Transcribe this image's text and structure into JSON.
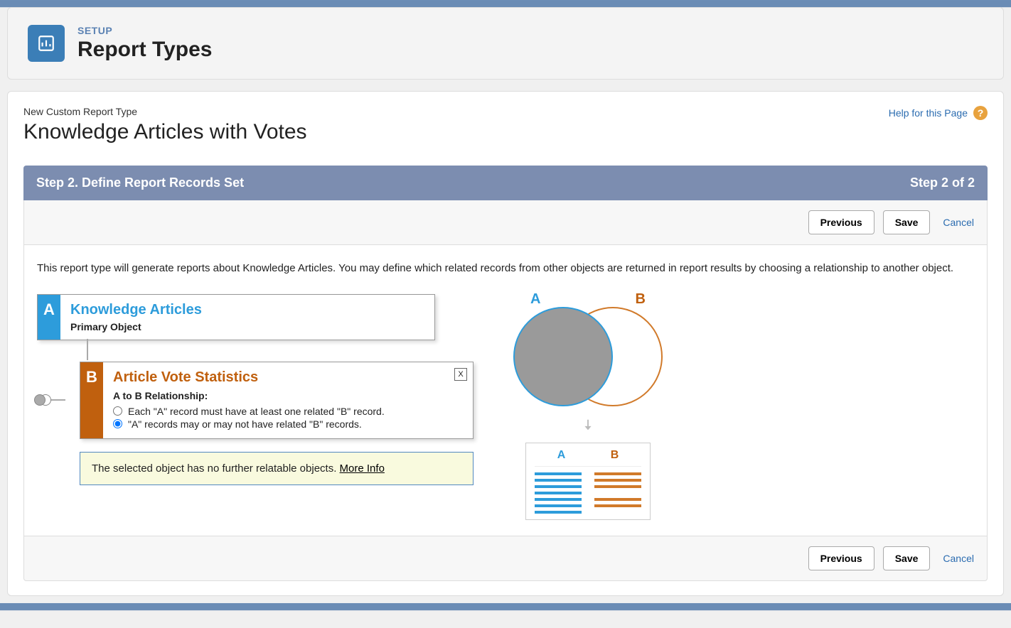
{
  "header": {
    "setup_label": "SETUP",
    "page_title": "Report Types"
  },
  "page": {
    "breadcrumb": "New Custom Report Type",
    "title": "Knowledge Articles with Votes",
    "help_label": "Help for this Page"
  },
  "step": {
    "label": "Step 2. Define Report Records Set",
    "counter": "Step 2 of 2"
  },
  "buttons": {
    "previous": "Previous",
    "save": "Save",
    "cancel": "Cancel"
  },
  "description": "This report type will generate reports about Knowledge Articles. You may define which related records from other objects are returned in report results by choosing a relationship to another object.",
  "object_a": {
    "letter": "A",
    "title": "Knowledge Articles",
    "subtitle": "Primary Object"
  },
  "object_b": {
    "letter": "B",
    "title": "Article Vote Statistics",
    "relationship_label": "A to B Relationship:",
    "option1": "Each \"A\" record must have at least one related \"B\" record.",
    "option2": "\"A\" records may or may not have related \"B\" records.",
    "close_label": "X"
  },
  "info": {
    "text": "The selected object has no further relatable objects. ",
    "link": "More Info"
  },
  "diagram": {
    "label_a": "A",
    "label_b": "B"
  }
}
